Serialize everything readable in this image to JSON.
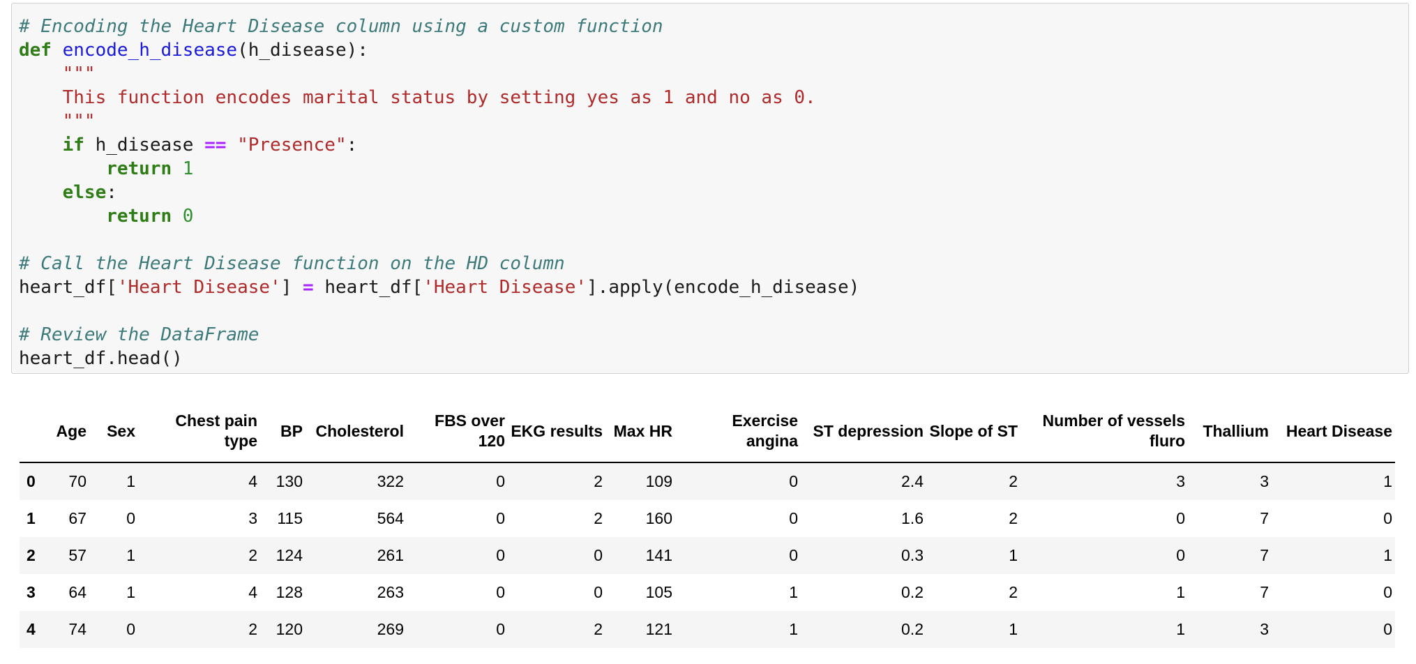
{
  "code": {
    "line1_comment": "# Encoding the Heart Disease column using a custom function",
    "line2_def": "def",
    "line2_fn": "encode_h_disease",
    "line2_args": "(h_disease):",
    "line3_doc_open": "    \"\"\"",
    "line4_doc": "    This function encodes marital status by setting yes as 1 and no as 0.",
    "line5_doc_close": "    \"\"\"",
    "line6_if": "    if",
    "line6_var": " h_disease ",
    "line6_op": "==",
    "line6_str": "\"Presence\"",
    "line6_colon": ":",
    "line7_return": "        return",
    "line7_val": " 1",
    "line8_else": "    else",
    "line8_colon": ":",
    "line9_return": "        return",
    "line9_val": " 0",
    "line11_comment": "# Call the Heart Disease function on the HD column",
    "line12_a": "heart_df[",
    "line12_str1": "'Heart Disease'",
    "line12_b": "] ",
    "line12_op": "=",
    "line12_c": " heart_df[",
    "line12_str2": "'Heart Disease'",
    "line12_d": "].apply(encode_h_disease)",
    "line14_comment": "# Review the DataFrame",
    "line15": "heart_df.head()"
  },
  "table": {
    "columns": [
      "",
      "Age",
      "Sex",
      "Chest pain type",
      "BP",
      "Cholesterol",
      "FBS over 120",
      "EKG results",
      "Max HR",
      "Exercise angina",
      "ST depression",
      "Slope of ST",
      "Number of vessels fluro",
      "Thallium",
      "Heart Disease"
    ],
    "rows": [
      [
        "0",
        "70",
        "1",
        "4",
        "130",
        "322",
        "0",
        "2",
        "109",
        "0",
        "2.4",
        "2",
        "3",
        "3",
        "1"
      ],
      [
        "1",
        "67",
        "0",
        "3",
        "115",
        "564",
        "0",
        "2",
        "160",
        "0",
        "1.6",
        "2",
        "0",
        "7",
        "0"
      ],
      [
        "2",
        "57",
        "1",
        "2",
        "124",
        "261",
        "0",
        "0",
        "141",
        "0",
        "0.3",
        "1",
        "0",
        "7",
        "1"
      ],
      [
        "3",
        "64",
        "1",
        "4",
        "128",
        "263",
        "0",
        "0",
        "105",
        "1",
        "0.2",
        "2",
        "1",
        "7",
        "0"
      ],
      [
        "4",
        "74",
        "0",
        "2",
        "120",
        "269",
        "0",
        "2",
        "121",
        "1",
        "0.2",
        "1",
        "1",
        "3",
        "0"
      ]
    ]
  }
}
